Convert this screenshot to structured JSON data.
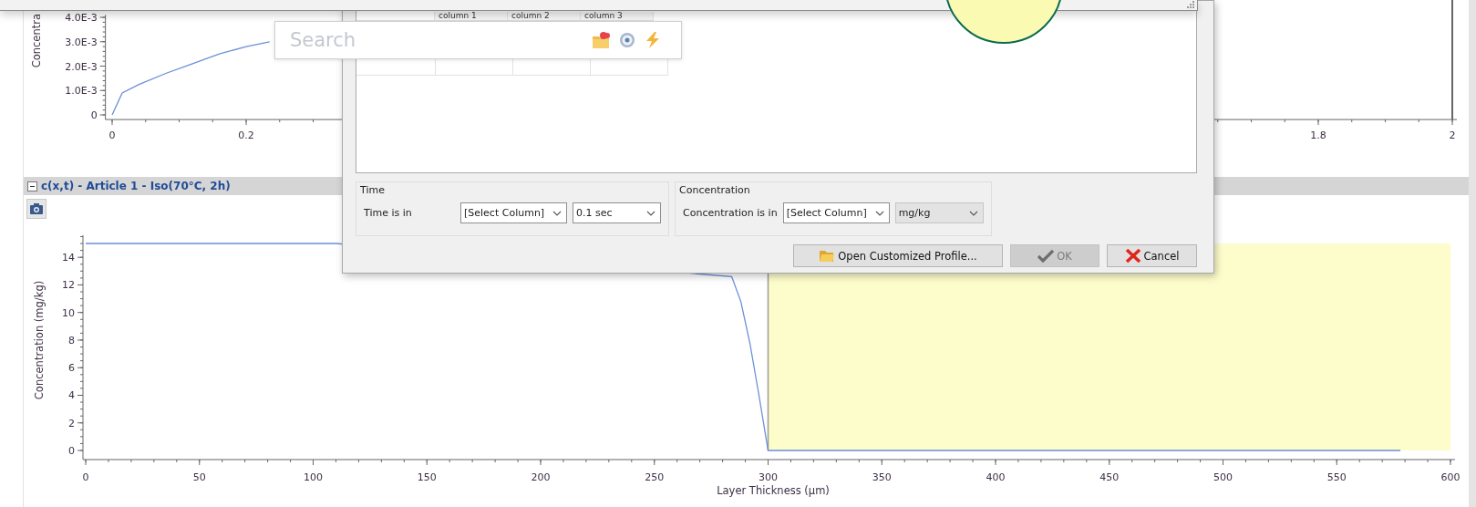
{
  "top_chart": {
    "chart_data": {
      "type": "line",
      "ylabel": "Concentra",
      "xlim": [
        -0.01,
        2
      ],
      "ylim": [
        -0.00019,
        0.0041
      ],
      "xticks": [
        0,
        0.2,
        1.8,
        2
      ],
      "yticks": [
        {
          "value": 0,
          "label": "0"
        },
        {
          "value": 0.001,
          "label": "1.0E-3"
        },
        {
          "value": 0.002,
          "label": "2.0E-3"
        },
        {
          "value": 0.003,
          "label": "3.0E-3"
        },
        {
          "value": 0.004,
          "label": "4.0E-3"
        }
      ],
      "series": [
        {
          "color": "#6b8fd8",
          "values": [
            0,
            0.0009,
            0.00125,
            0.0017,
            0.0021,
            0.0025,
            0.0028,
            0.003
          ]
        }
      ],
      "x": [
        0,
        0.015,
        0.04,
        0.08,
        0.12,
        0.16,
        0.2,
        0.235
      ]
    }
  },
  "section": {
    "title": "c(x,t) - Article 1 - Iso(70°C, 2h)",
    "expanded": true
  },
  "bottom_chart": {
    "chart_data": {
      "type": "line",
      "xlabel": "Layer Thickness (μm)",
      "ylabel": "Concentration (mg/kg)",
      "xlim": [
        -1.2,
        600
      ],
      "ylim": [
        -0.66,
        15.6
      ],
      "xticks": [
        0,
        50,
        100,
        150,
        200,
        250,
        300,
        350,
        400,
        450,
        500,
        550,
        600
      ],
      "yticks": [
        0,
        2,
        4,
        6,
        8,
        10,
        12,
        14
      ],
      "x": [
        0,
        110,
        284,
        288,
        292,
        296,
        300,
        578
      ],
      "series": [
        {
          "color": "#6b8fd8",
          "values": [
            15,
            15,
            12.6,
            10.8,
            7.8,
            4,
            0,
            0
          ]
        }
      ],
      "bands": [
        {
          "axis": "x",
          "from": 300,
          "to": 600,
          "color": "#fdfdcc"
        }
      ]
    }
  },
  "dialog": {
    "grid": {
      "columns": [
        "column 1",
        "column 2",
        "column 3"
      ]
    },
    "groups": [
      {
        "title": "Time",
        "label": "Time is in",
        "fields": [
          {
            "value": "[Select Column]",
            "disabled": false
          },
          {
            "value": "0.1 sec",
            "disabled": false
          }
        ]
      },
      {
        "title": "Concentration",
        "label": "Concentration is in",
        "fields": [
          {
            "value": "[Select Column]",
            "disabled": false
          },
          {
            "value": "mg/kg",
            "disabled": true
          }
        ]
      }
    ],
    "buttons": [
      {
        "label": "Open Customized Profile...",
        "kind": "open",
        "disabled": false
      },
      {
        "label": "OK",
        "kind": "ok",
        "disabled": true
      },
      {
        "label": "Cancel",
        "kind": "cancel",
        "disabled": false
      }
    ]
  },
  "search": {
    "placeholder": "Search"
  }
}
